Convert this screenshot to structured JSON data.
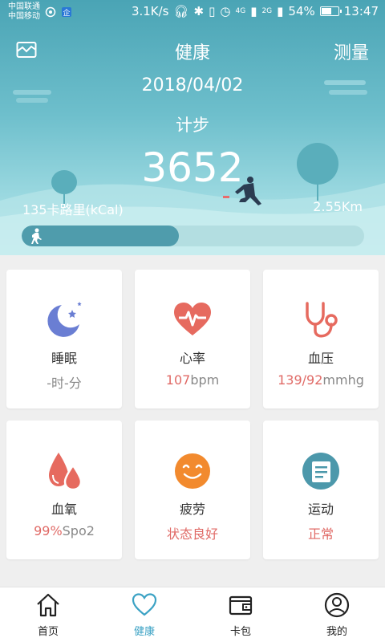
{
  "status_bar": {
    "carrier1": "中国联通",
    "carrier2": "中国移动",
    "speed": "3.1K/s",
    "signal1": "4G",
    "signal2": "2G",
    "battery": "54%",
    "time": "13:47"
  },
  "header": {
    "title": "健康",
    "right_action": "测量",
    "left_icon": "trend-chart-icon"
  },
  "steps": {
    "date": "2018/04/02",
    "label": "计步",
    "count": "3652",
    "calories": "135卡路里(kCal)",
    "distance": "2.55Km",
    "progress": 0.46
  },
  "cards": [
    {
      "id": "sleep",
      "name": "睡眠",
      "value": "-时-分",
      "value_style": "plain",
      "icon": "moon-stars-icon",
      "icon_color": "#6a7ed3"
    },
    {
      "id": "heart",
      "name": "心率",
      "value_num": "107",
      "value_unit": "bpm",
      "icon": "heart-pulse-icon",
      "icon_color": "#e66a5f"
    },
    {
      "id": "bp",
      "name": "血压",
      "value_num": "139/92",
      "value_unit": "mmhg",
      "icon": "stethoscope-icon",
      "icon_color": "#e66a5f"
    },
    {
      "id": "spo2",
      "name": "血氧",
      "value_num": "99%",
      "value_unit": "Spo2",
      "icon": "drops-icon",
      "icon_color": "#e66a5f"
    },
    {
      "id": "fatigue",
      "name": "疲劳",
      "value": "状态良好",
      "value_style": "red",
      "icon": "smile-icon",
      "icon_color": "#f28a2e"
    },
    {
      "id": "sport",
      "name": "运动",
      "value": "正常",
      "value_style": "red",
      "icon": "document-icon",
      "icon_color": "#4c98ab"
    }
  ],
  "tabs": [
    {
      "label": "首页",
      "icon": "home-icon",
      "active": false
    },
    {
      "label": "健康",
      "icon": "heart-icon",
      "active": true
    },
    {
      "label": "卡包",
      "icon": "wallet-icon",
      "active": false
    },
    {
      "label": "我的",
      "icon": "user-icon",
      "active": false
    }
  ],
  "colors": {
    "accent": "#3ba2c4",
    "value_red": "#e06a66",
    "hero_top": "#4aa4b5"
  }
}
